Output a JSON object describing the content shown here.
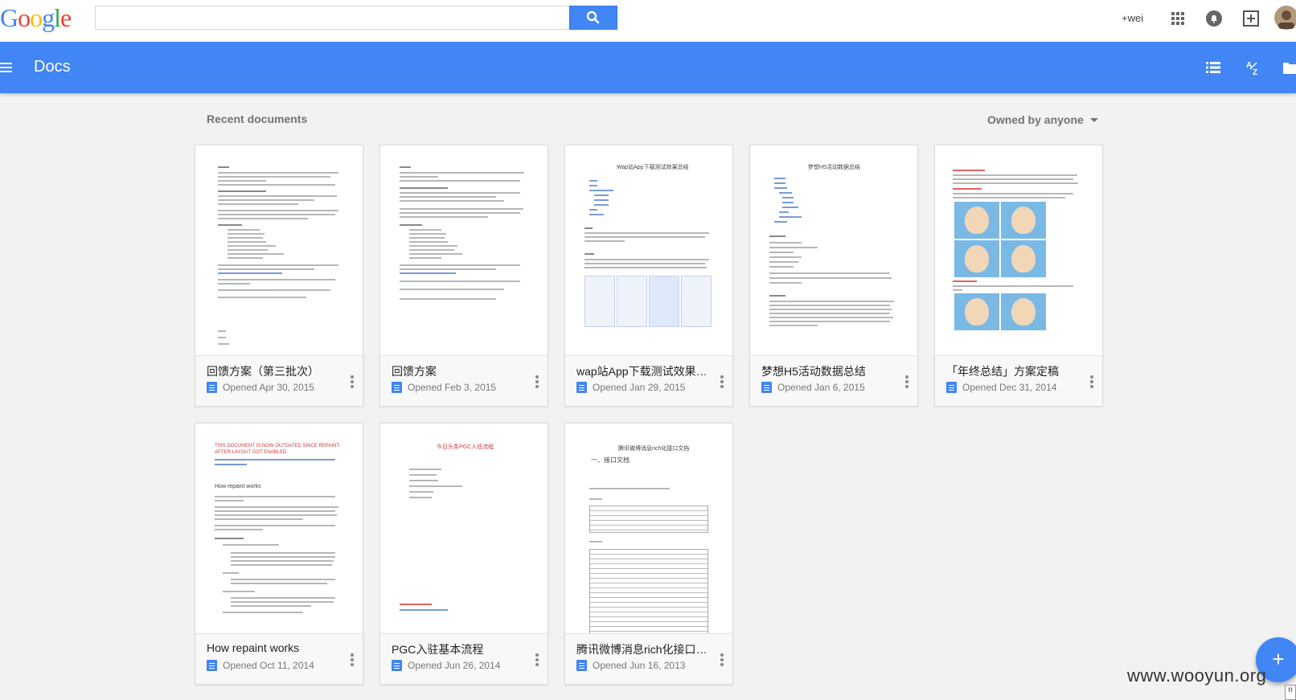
{
  "google": {
    "logo": [
      "G",
      "o",
      "o",
      "g",
      "l",
      "e"
    ],
    "search_value": "",
    "search_placeholder": "",
    "user_name": "+wei"
  },
  "docs_header": {
    "title": "Docs"
  },
  "content": {
    "section_title": "Recent documents",
    "owner_filter": "Owned by anyone"
  },
  "documents": [
    {
      "title": "回馈方案（第三批次）",
      "opened": "Opened Apr 30, 2015"
    },
    {
      "title": "回馈方案",
      "opened": "Opened Feb 3, 2015"
    },
    {
      "title": "wap站App下载测试效果总结",
      "opened": "Opened Jan 29, 2015"
    },
    {
      "title": "梦想H5活动数据总结",
      "opened": "Opened Jan 6, 2015"
    },
    {
      "title": "「年终总结」方案定稿",
      "opened": "Opened Dec 31, 2014"
    },
    {
      "title": "How repaint works",
      "opened": "Opened Oct 11, 2014"
    },
    {
      "title": "PGC入驻基本流程",
      "opened": "Opened Jun 26, 2014"
    },
    {
      "title": "腾讯微博消息rich化接口文档",
      "opened": "Opened Jun 16, 2013"
    }
  ],
  "thumbnails": {
    "doc3_heading": "Wap站App下载测试效果总结",
    "doc4_heading": "梦想H5活动数据总结",
    "doc6_heading": "THIS DOCUMENT IS NOW OUTDATED SINCE REPAINT-AFTER-LAYOUT GOT ENABLED",
    "doc6_subheading": "How repaint works",
    "doc7_heading": "今日头条PGC入驻流程",
    "doc8_heading": "腾讯微博消息rich化接口文档",
    "doc8_subheading": "一、接口文档"
  },
  "fab_label": "+",
  "watermark": "www.wooyun.org",
  "corner_label": "n",
  "colors": {
    "accent": "#4285f4",
    "background": "#f2f2f2"
  }
}
